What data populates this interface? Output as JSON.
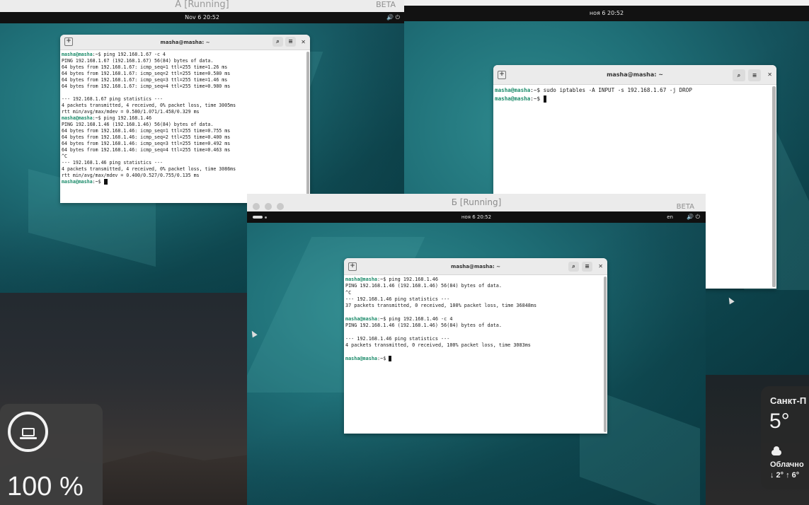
{
  "vm_a": {
    "window_title": "A [Running]",
    "beta": "BETA",
    "clock": "Nov 6  20:52",
    "tray": "🔊 ⏻",
    "terminal": {
      "title": "masha@masha: ~",
      "lines": [
        {
          "prompt": "masha@masha",
          "rest": ":~$ ping 192.168.1.67 -c 4"
        },
        {
          "text": "PING 192.168.1.67 (192.168.1.67) 56(84) bytes of data."
        },
        {
          "text": "64 bytes from 192.168.1.67: icmp_seq=1 ttl=255 time=1.26 ms"
        },
        {
          "text": "64 bytes from 192.168.1.67: icmp_seq=2 ttl=255 time=0.580 ms"
        },
        {
          "text": "64 bytes from 192.168.1.67: icmp_seq=3 ttl=255 time=1.46 ms"
        },
        {
          "text": "64 bytes from 192.168.1.67: icmp_seq=4 ttl=255 time=0.980 ms"
        },
        {
          "text": ""
        },
        {
          "text": "--- 192.168.1.67 ping statistics ---"
        },
        {
          "text": "4 packets transmitted, 4 received, 0% packet loss, time 3005ms"
        },
        {
          "text": "rtt min/avg/max/mdev = 0.580/1.071/1.458/0.329 ms"
        },
        {
          "prompt": "masha@masha",
          "rest": ":~$ ping 192.168.1.46"
        },
        {
          "text": "PING 192.168.1.46 (192.168.1.46) 56(84) bytes of data."
        },
        {
          "text": "64 bytes from 192.168.1.46: icmp_seq=1 ttl=255 time=0.755 ms"
        },
        {
          "text": "64 bytes from 192.168.1.46: icmp_seq=2 ttl=255 time=0.400 ms"
        },
        {
          "text": "64 bytes from 192.168.1.46: icmp_seq=3 ttl=255 time=0.492 ms"
        },
        {
          "text": "64 bytes from 192.168.1.46: icmp_seq=4 ttl=255 time=0.463 ms"
        },
        {
          "text": "^C"
        },
        {
          "text": "--- 192.168.1.46 ping statistics ---"
        },
        {
          "text": "4 packets transmitted, 4 received, 0% packet loss, time 3086ms"
        },
        {
          "text": "rtt min/avg/max/mdev = 0.400/0.527/0.755/0.135 ms"
        },
        {
          "prompt": "masha@masha",
          "rest": ":~$ ",
          "cursor": true
        }
      ]
    }
  },
  "vm_r": {
    "clock": "ноя 6  20:52",
    "terminal": {
      "title": "masha@masha: ~",
      "lines": [
        {
          "prompt": "masha@masha",
          "rest": ":~$ sudo iptables -A INPUT -s 192.168.1.67 -j DROP"
        },
        {
          "prompt": "masha@masha",
          "rest": ":~$ ",
          "cursor": true
        }
      ]
    }
  },
  "vm_b": {
    "window_title": "Б [Running]",
    "beta": "BETA",
    "clock": "ноя 6  20:52",
    "lang": "en",
    "tray": "🔊 ⏻",
    "terminal": {
      "title": "masha@masha: ~",
      "lines": [
        {
          "prompt": "masha@masha",
          "rest": ":~$ ping 192.168.1.46"
        },
        {
          "text": "PING 192.168.1.46 (192.168.1.46) 56(84) bytes of data."
        },
        {
          "text": "^C"
        },
        {
          "text": "--- 192.168.1.46 ping statistics ---"
        },
        {
          "text": "37 packets transmitted, 0 received, 100% packet loss, time 36848ms"
        },
        {
          "text": ""
        },
        {
          "prompt": "masha@masha",
          "rest": ":~$ ping 192.168.1.46 -c 4"
        },
        {
          "text": "PING 192.168.1.46 (192.168.1.46) 56(84) bytes of data."
        },
        {
          "text": ""
        },
        {
          "text": "--- 192.168.1.46 ping statistics ---"
        },
        {
          "text": "4 packets transmitted, 0 received, 100% packet loss, time 3083ms"
        },
        {
          "text": ""
        },
        {
          "prompt": "masha@masha",
          "rest": ":~$ ",
          "cursor": true
        }
      ]
    }
  },
  "host": {
    "battery_percent": "100 %",
    "battery_level": 1.0,
    "weather": {
      "city": "Санкт-П",
      "temp": "5°",
      "condition": "Облачно",
      "range": "↓ 2° ↑ 6°"
    }
  },
  "colors": {
    "prompt": "#1d8c6b",
    "desktop_teal": "#1f6f77",
    "terminal_bg": "#ffffff"
  },
  "icons": [
    "new-tab-icon",
    "search-icon",
    "menu-icon",
    "close-icon",
    "volume-icon",
    "power-icon",
    "laptop-icon",
    "cloud-icon"
  ]
}
